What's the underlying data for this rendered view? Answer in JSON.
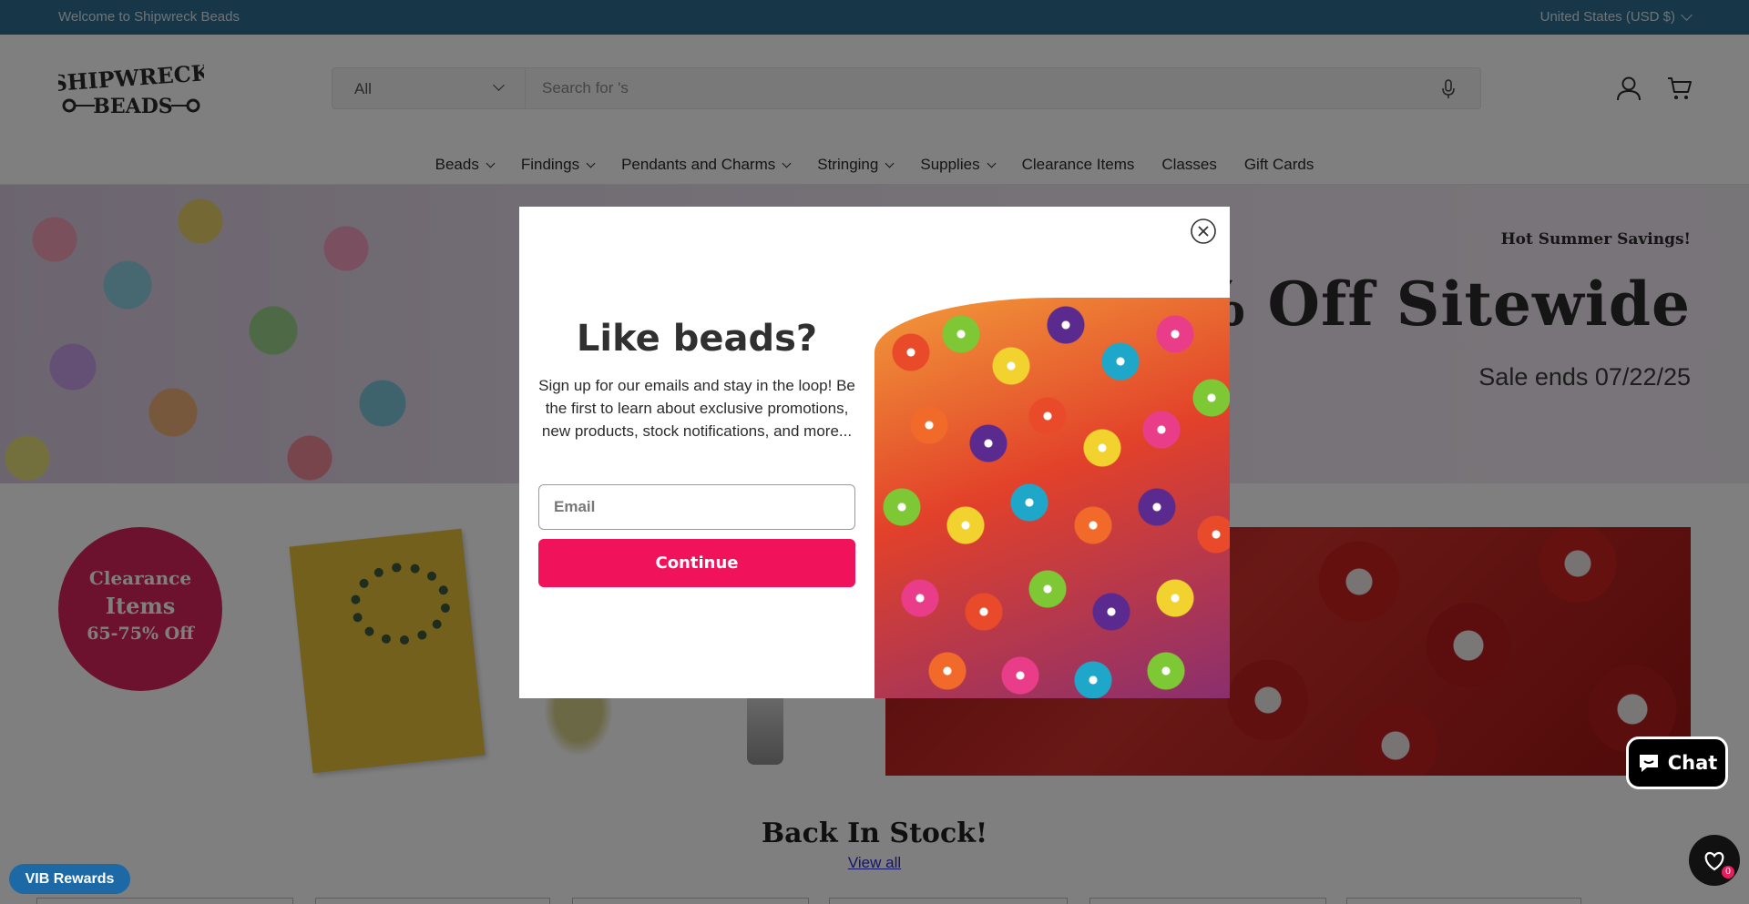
{
  "announcement": {
    "welcome": "Welcome to Shipwreck Beads",
    "currency": "United States (USD $)"
  },
  "header": {
    "logo_line1": "SHIPWRECK",
    "logo_line2": "BEADS",
    "search": {
      "category": "All",
      "placeholder": "Search for 's"
    },
    "nav": [
      {
        "label": "Beads",
        "dropdown": true
      },
      {
        "label": "Findings",
        "dropdown": true
      },
      {
        "label": "Pendants and Charms",
        "dropdown": true
      },
      {
        "label": "Stringing",
        "dropdown": true
      },
      {
        "label": "Supplies",
        "dropdown": true
      },
      {
        "label": "Clearance Items",
        "dropdown": false
      },
      {
        "label": "Classes",
        "dropdown": false
      },
      {
        "label": "Gift Cards",
        "dropdown": false
      }
    ]
  },
  "hero": {
    "eyebrow": "Hot Summer Savings!",
    "headline": "0% Off Sitewide",
    "sale_ends": "Sale ends 07/22/25"
  },
  "promo_badge": {
    "line1": "Clearance",
    "line2": "Items",
    "line3": "65-75% Off"
  },
  "section": {
    "title": "Back In Stock!",
    "link": "View all"
  },
  "modal": {
    "title": "Like beads?",
    "description": "Sign up for our emails and stay in the loop! Be the first to learn about exclusive promotions, new products, stock notifications, and more...",
    "email_placeholder": "Email",
    "button": "Continue"
  },
  "widgets": {
    "chat_label": "Chat",
    "wishlist_count": "0",
    "rewards_label": "VIB Rewards"
  },
  "colors": {
    "announce_bar": "#2f6e93",
    "accent_pink": "#f0135c",
    "badge": "#d8245c",
    "rewards": "#1c69a6"
  }
}
